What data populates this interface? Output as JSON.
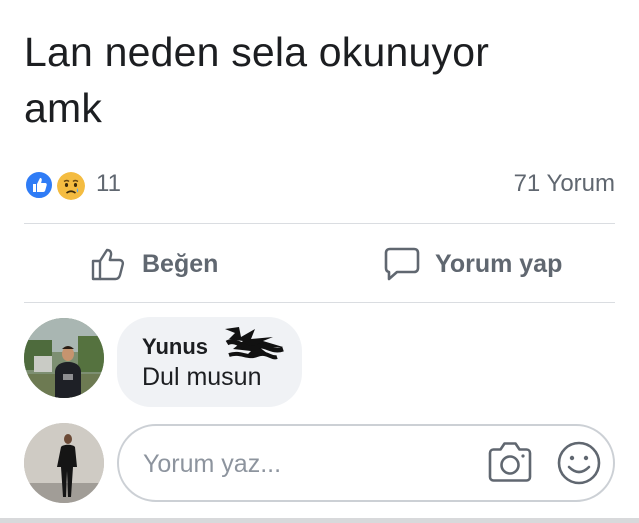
{
  "post": {
    "text_line1": "Lan neden sela okunuyor",
    "text_line2": "amk"
  },
  "reactions": {
    "icons": [
      "like-icon",
      "sad-icon"
    ],
    "count": "11",
    "comments_count": "71 Yorum"
  },
  "actions": {
    "like_label": "Beğen",
    "comment_label": "Yorum yap"
  },
  "comment": {
    "author": "Yunus",
    "text": "Dul musun"
  },
  "compose": {
    "placeholder": "Yorum yaz..."
  },
  "colors": {
    "like_blue": "#2f7cf6",
    "sad_yellow": "#f6c343",
    "text_primary": "#1c1e21",
    "text_secondary": "#606770",
    "bubble_bg": "#f0f2f5",
    "divider": "#dadde1"
  }
}
